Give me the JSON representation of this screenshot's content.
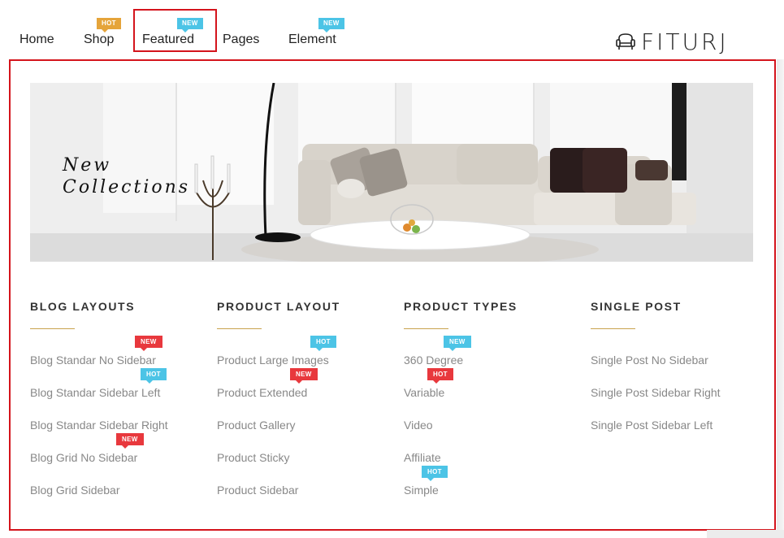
{
  "nav": {
    "items": [
      {
        "label": "Home"
      },
      {
        "label": "Shop",
        "badge": "HOT"
      },
      {
        "label": "Featured",
        "badge": "NEW"
      },
      {
        "label": "Pages"
      },
      {
        "label": "Element",
        "badge": "NEW"
      }
    ]
  },
  "logo": {
    "text": "FITURJ",
    "icon": "armchair-icon"
  },
  "banner": {
    "line1": "New",
    "line2": "Collections"
  },
  "columns": [
    {
      "title": "BLOG LAYOUTS",
      "items": [
        {
          "label": "Blog Standar No Sidebar",
          "badge": "NEW"
        },
        {
          "label": "Blog Standar Sidebar Left",
          "badge": "HOT"
        },
        {
          "label": "Blog Standar Sidebar Right"
        },
        {
          "label": "Blog Grid No Sidebar",
          "badge": "NEW"
        },
        {
          "label": "Blog Grid Sidebar"
        }
      ]
    },
    {
      "title": "PRODUCT LAYOUT",
      "items": [
        {
          "label": "Product Large Images",
          "badge": "HOT"
        },
        {
          "label": "Product Extended",
          "badge": "NEW"
        },
        {
          "label": "Product Gallery"
        },
        {
          "label": "Product Sticky"
        },
        {
          "label": "Product Sidebar"
        }
      ]
    },
    {
      "title": "PRODUCT TYPES",
      "items": [
        {
          "label": "360 Degree",
          "badge": "NEW"
        },
        {
          "label": "Variable",
          "badge": "HOT"
        },
        {
          "label": "Video"
        },
        {
          "label": "Affiliate"
        },
        {
          "label": "Simple",
          "badge": "HOT"
        }
      ]
    },
    {
      "title": "SINGLE POST",
      "items": [
        {
          "label": "Single Post No Sidebar"
        },
        {
          "label": "Single Post Sidebar Right"
        },
        {
          "label": "Single Post Sidebar Left"
        }
      ]
    }
  ],
  "colors": {
    "highlight": "#d4141c",
    "badge_hot_orange": "#e5a43a",
    "badge_blue": "#4cc4e6",
    "badge_red": "#e8383d",
    "title_underline": "#c9a34e"
  }
}
